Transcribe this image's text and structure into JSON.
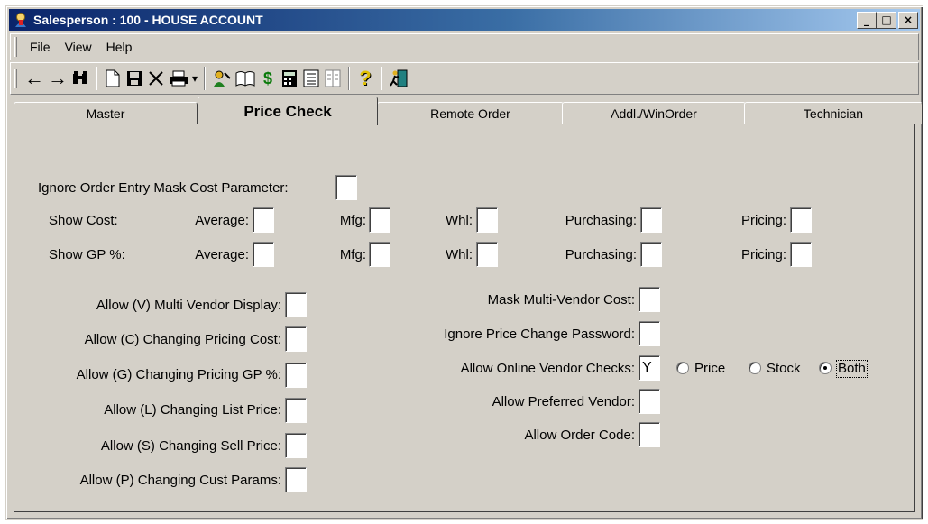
{
  "window": {
    "title": "Salesperson : 100 - HOUSE ACCOUNT",
    "minimize": "_",
    "maximize": "□",
    "close": "×"
  },
  "menu": [
    {
      "label": "File"
    },
    {
      "label": "View"
    },
    {
      "label": "Help"
    }
  ],
  "toolbar": {
    "back_glyph": "←",
    "forward_glyph": "→",
    "find_glyph": "🔭",
    "new_glyph": "🗋",
    "save_glyph": "💾",
    "delete_glyph": "✕",
    "print_glyph": "🖶",
    "dropdown_glyph": "▾",
    "dollar_glyph": "$",
    "help_glyph": "?"
  },
  "tabs": [
    {
      "label": "Master",
      "active": false
    },
    {
      "label": "Price Check",
      "active": true
    },
    {
      "label": "Remote Order",
      "active": false
    },
    {
      "label": "Addl./WinOrder",
      "active": false
    },
    {
      "label": "Technician",
      "active": false
    }
  ],
  "price_check": {
    "ignore_mask_cost": {
      "label": "Ignore Order Entry Mask Cost Parameter:",
      "value": ""
    },
    "show_cost": {
      "label": "Show Cost:",
      "average": {
        "label": "Average:",
        "value": ""
      },
      "mfg": {
        "label": "Mfg:",
        "value": ""
      },
      "whl": {
        "label": "Whl:",
        "value": ""
      },
      "purchasing": {
        "label": "Purchasing:",
        "value": ""
      },
      "pricing": {
        "label": "Pricing:",
        "value": ""
      }
    },
    "show_gp": {
      "label": "Show GP %:",
      "average": {
        "label": "Average:",
        "value": ""
      },
      "mfg": {
        "label": "Mfg:",
        "value": ""
      },
      "whl": {
        "label": "Whl:",
        "value": ""
      },
      "purchasing": {
        "label": "Purchasing:",
        "value": ""
      },
      "pricing": {
        "label": "Pricing:",
        "value": ""
      }
    },
    "left_options": [
      {
        "label": "Allow (V) Multi Vendor Display:",
        "value": ""
      },
      {
        "label": "Allow (C) Changing Pricing Cost:",
        "value": ""
      },
      {
        "label": "Allow (G) Changing Pricing GP %:",
        "value": ""
      },
      {
        "label": "Allow (L) Changing List Price:",
        "value": ""
      },
      {
        "label": "Allow (S) Changing Sell Price:",
        "value": ""
      },
      {
        "label": "Allow (P) Changing Cust Params:",
        "value": ""
      }
    ],
    "right_options": [
      {
        "label": "Mask Multi-Vendor Cost:",
        "value": ""
      },
      {
        "label": "Ignore Price Change Password:",
        "value": ""
      },
      {
        "label": "Allow Online Vendor Checks:",
        "value": "Y"
      },
      {
        "label": "Allow Preferred Vendor:",
        "value": ""
      },
      {
        "label": "Allow Order Code:",
        "value": ""
      }
    ],
    "vendor_check_mode": {
      "options": [
        "Price",
        "Stock",
        "Both"
      ],
      "selected": "Both"
    }
  }
}
